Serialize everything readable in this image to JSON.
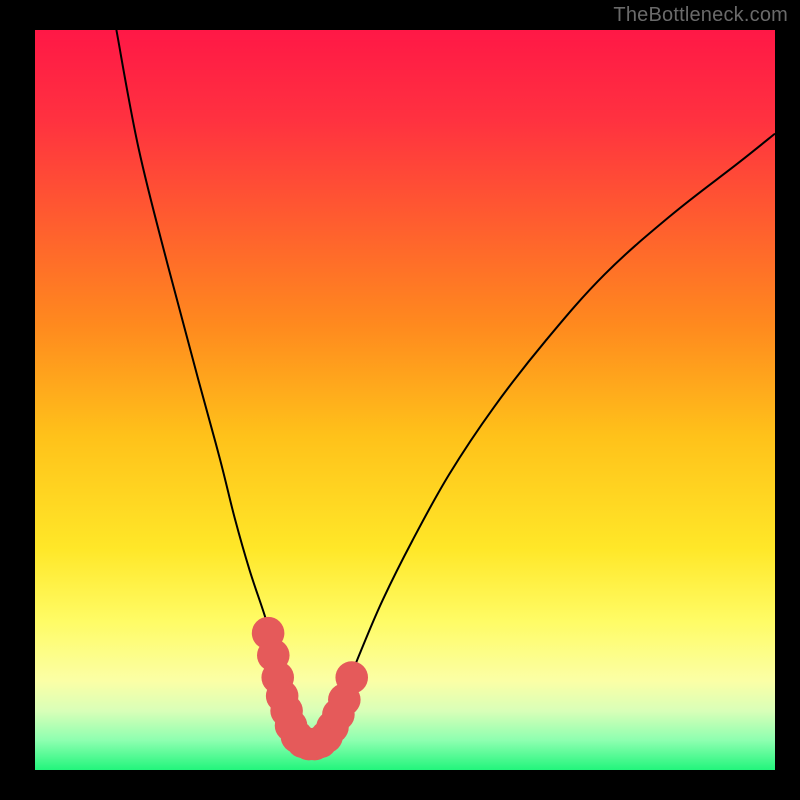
{
  "watermark": "TheBottleneck.com",
  "chart_data": {
    "type": "line",
    "title": "",
    "xlabel": "",
    "ylabel": "",
    "xlim": [
      0,
      100
    ],
    "ylim": [
      0,
      100
    ],
    "gradient_stops": [
      {
        "offset": 0,
        "color": "#ff1846"
      },
      {
        "offset": 12,
        "color": "#ff3140"
      },
      {
        "offset": 25,
        "color": "#ff5a30"
      },
      {
        "offset": 40,
        "color": "#ff8a1e"
      },
      {
        "offset": 55,
        "color": "#ffc21a"
      },
      {
        "offset": 70,
        "color": "#ffe728"
      },
      {
        "offset": 80,
        "color": "#fffc66"
      },
      {
        "offset": 88,
        "color": "#fbffa6"
      },
      {
        "offset": 92,
        "color": "#d9ffb8"
      },
      {
        "offset": 96,
        "color": "#8dffb0"
      },
      {
        "offset": 100,
        "color": "#22f57c"
      }
    ],
    "series": [
      {
        "name": "bottleneck-curve",
        "color": "#000000",
        "x": [
          11,
          14,
          18,
          22,
          25,
          27,
          29,
          31,
          32.5,
          34,
          35.2,
          36.2,
          37,
          37.8,
          39,
          40.5,
          42,
          44,
          47,
          51,
          56,
          62,
          69,
          77,
          86,
          95,
          100
        ],
        "y": [
          100,
          84,
          68,
          53,
          42,
          34,
          27,
          21,
          16,
          11.5,
          8,
          5.5,
          4,
          4,
          5,
          7.5,
          11,
          16,
          23,
          31,
          40,
          49,
          58,
          67,
          75,
          82,
          86
        ]
      }
    ],
    "markers": {
      "name": "highlight-markers",
      "color": "#e55a5a",
      "radius": 2.2,
      "points": [
        {
          "x": 31.5,
          "y": 18.5
        },
        {
          "x": 32.2,
          "y": 15.5
        },
        {
          "x": 32.8,
          "y": 12.5
        },
        {
          "x": 33.4,
          "y": 10.0
        },
        {
          "x": 34.0,
          "y": 8.0
        },
        {
          "x": 34.6,
          "y": 6.0
        },
        {
          "x": 35.4,
          "y": 4.5
        },
        {
          "x": 36.2,
          "y": 3.8
        },
        {
          "x": 37.0,
          "y": 3.5
        },
        {
          "x": 37.8,
          "y": 3.5
        },
        {
          "x": 38.6,
          "y": 3.8
        },
        {
          "x": 39.4,
          "y": 4.5
        },
        {
          "x": 40.2,
          "y": 5.8
        },
        {
          "x": 41.0,
          "y": 7.5
        },
        {
          "x": 41.8,
          "y": 9.5
        },
        {
          "x": 42.8,
          "y": 12.5
        }
      ]
    }
  }
}
